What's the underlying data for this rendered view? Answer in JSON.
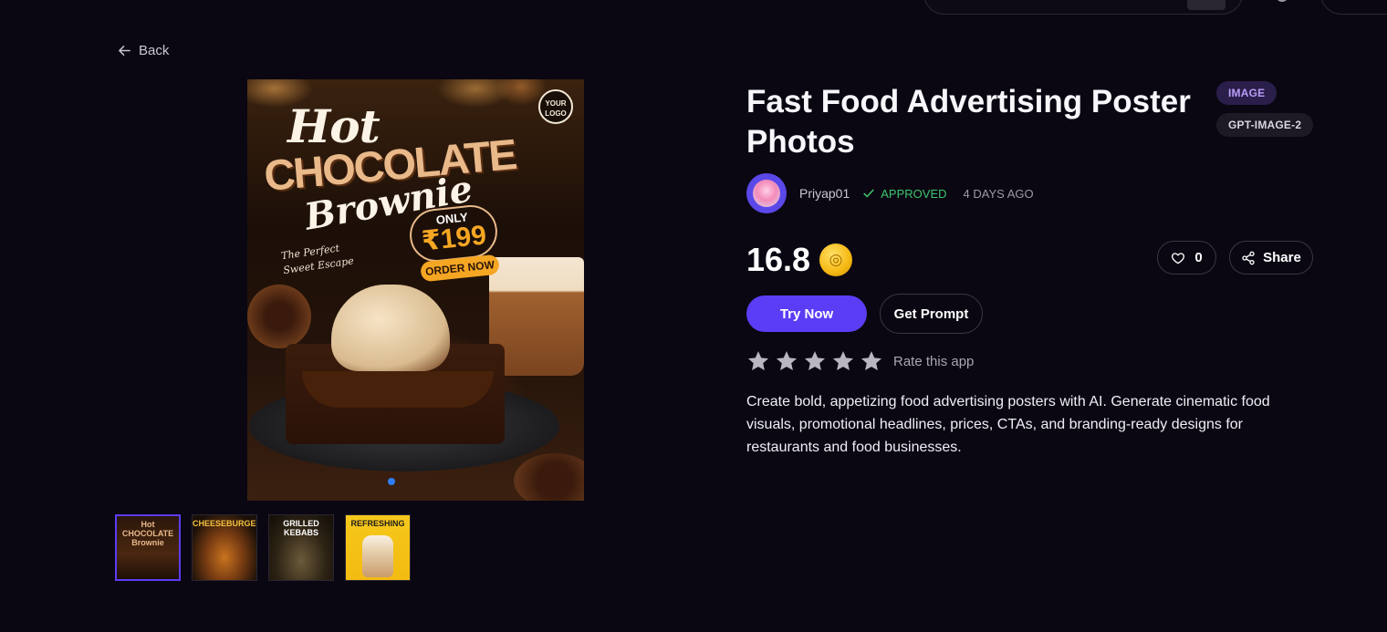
{
  "nav": {
    "back_label": "Back"
  },
  "gallery": {
    "main_image": {
      "logo_text": "YOUR LOGO",
      "headline_hot": "Hot",
      "headline_chocolate": "CHOCOLATE",
      "headline_brownie": "Brownie",
      "tagline": "The Perfect Sweet Escape",
      "price_prefix": "ONLY",
      "price": "₹199",
      "cta": "ORDER NOW"
    },
    "thumbnails": [
      {
        "label": "Hot CHOCOLATE Brownie",
        "active": true
      },
      {
        "label": "CHEESEBURGER",
        "active": false
      },
      {
        "label": "GRILLED KEBABS",
        "active": false
      },
      {
        "label": "REFRESHING",
        "active": false
      }
    ]
  },
  "details": {
    "title": "Fast Food Advertising Poster Photos",
    "tags": [
      "IMAGE",
      "GPT-IMAGE-2"
    ],
    "author": "Priyap01",
    "status": "APPROVED",
    "time_ago": "4 DAYS AGO",
    "price": "16.8",
    "coin_icon": "coin-icon",
    "likes": "0",
    "share_label": "Share",
    "try_label": "Try Now",
    "prompt_label": "Get Prompt",
    "rating_label": "Rate this app",
    "stars": 5,
    "description": "Create bold, appetizing food advertising posters with AI. Generate cinematic food visuals, promotional headlines, prices, CTAs, and branding-ready designs for restaurants and food businesses."
  },
  "colors": {
    "background": "#0a0712",
    "accent": "#5b3df5",
    "approved": "#3ec46d",
    "coin": "#f5b812"
  }
}
